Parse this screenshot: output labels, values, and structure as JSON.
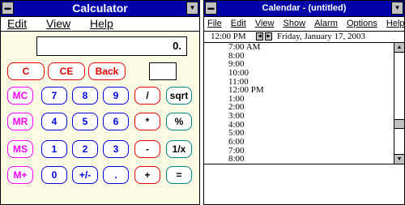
{
  "calculator": {
    "title": "Calculator",
    "menu": [
      "Edit",
      "View",
      "Help"
    ],
    "display": "0.",
    "buttons": {
      "c": "C",
      "ce": "CE",
      "back": "Back",
      "mc": "MC",
      "mr": "MR",
      "ms": "MS",
      "mplus": "M+",
      "d7": "7",
      "d8": "8",
      "d9": "9",
      "d4": "4",
      "d5": "5",
      "d6": "6",
      "d1": "1",
      "d2": "2",
      "d3": "3",
      "d0": "0",
      "sign": "+/-",
      "dot": ".",
      "div": "/",
      "sqrt": "sqrt",
      "mul": "*",
      "pct": "%",
      "sub": "-",
      "inv": "1/x",
      "add": "+",
      "eq": "="
    }
  },
  "calendar": {
    "title": "Calendar - (untitled)",
    "menu": [
      "File",
      "Edit",
      "View",
      "Show",
      "Alarm",
      "Options",
      "Help"
    ],
    "current_time": "12:00 PM",
    "date": "Friday, January 17, 2003",
    "times": [
      "7:00 AM",
      "8:00",
      "9:00",
      "10:00",
      "11:00",
      "12:00 PM",
      "1:00",
      "2:00",
      "3:00",
      "4:00",
      "5:00",
      "6:00",
      "7:00",
      "8:00"
    ]
  },
  "icons": {
    "system_menu": "system-menu-icon",
    "minimize": "minimize-arrow-icon",
    "scroll_up": "arrow-up-icon",
    "scroll_down": "arrow-down-icon",
    "prev_day": "arrow-left-icon",
    "next_day": "arrow-right-icon"
  },
  "colors": {
    "titlebar": "#0000a8",
    "calc_body": "#fbfbe4",
    "red_keys": "#e00000",
    "memory_keys": "#ff00ff",
    "digit_keys": "#0000e0"
  }
}
